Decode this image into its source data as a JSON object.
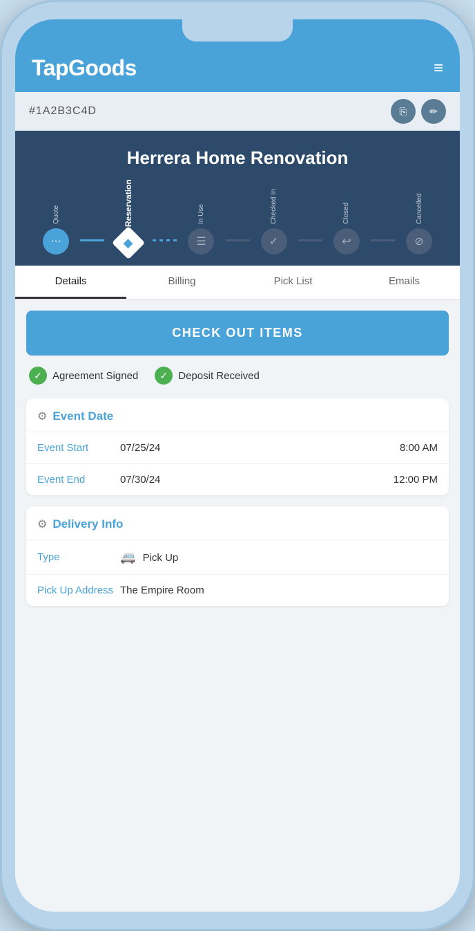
{
  "app": {
    "logo": "TapGoods",
    "hamburger": "≡"
  },
  "subheader": {
    "order_id": "#1A2B3C4D",
    "copy_icon": "⧉",
    "edit_icon": "✏"
  },
  "status_banner": {
    "project_name": "Herrera Home Renovation",
    "steps": [
      {
        "id": "quote",
        "label": "Quote",
        "type": "dots",
        "symbol": "···"
      },
      {
        "id": "reservation",
        "label": "Reservation",
        "type": "diamond-active",
        "symbol": "◆"
      },
      {
        "id": "in-use",
        "label": "In Use",
        "type": "inactive",
        "symbol": "≡"
      },
      {
        "id": "checked-in",
        "label": "Checked In",
        "type": "checked",
        "symbol": "✓"
      },
      {
        "id": "closed",
        "label": "Closed",
        "type": "checked",
        "symbol": "↩"
      },
      {
        "id": "cancelled",
        "label": "Cancelled",
        "type": "inactive",
        "symbol": "⊘"
      }
    ],
    "connectors": [
      "active",
      "dashed",
      "grey",
      "grey",
      "grey"
    ]
  },
  "tabs": [
    {
      "id": "details",
      "label": "Details",
      "active": true
    },
    {
      "id": "billing",
      "label": "Billing",
      "active": false
    },
    {
      "id": "pick-list",
      "label": "Pick List",
      "active": false
    },
    {
      "id": "emails",
      "label": "Emails",
      "active": false
    }
  ],
  "checkout_button": "CHECK OUT ITEMS",
  "badges": [
    {
      "id": "agreement",
      "label": "Agreement Signed",
      "checked": true
    },
    {
      "id": "deposit",
      "label": "Deposit Received",
      "checked": true
    }
  ],
  "event_date_card": {
    "title": "Event Date",
    "rows": [
      {
        "label": "Event Start",
        "date": "07/25/24",
        "time": "8:00 AM"
      },
      {
        "label": "Event End",
        "date": "07/30/24",
        "time": "12:00 PM"
      }
    ]
  },
  "delivery_card": {
    "title": "Delivery Info",
    "rows": [
      {
        "label": "Type",
        "icon": "🚐",
        "value": "Pick Up"
      },
      {
        "label": "Pick Up Address",
        "value": "The Empire Room"
      }
    ]
  }
}
